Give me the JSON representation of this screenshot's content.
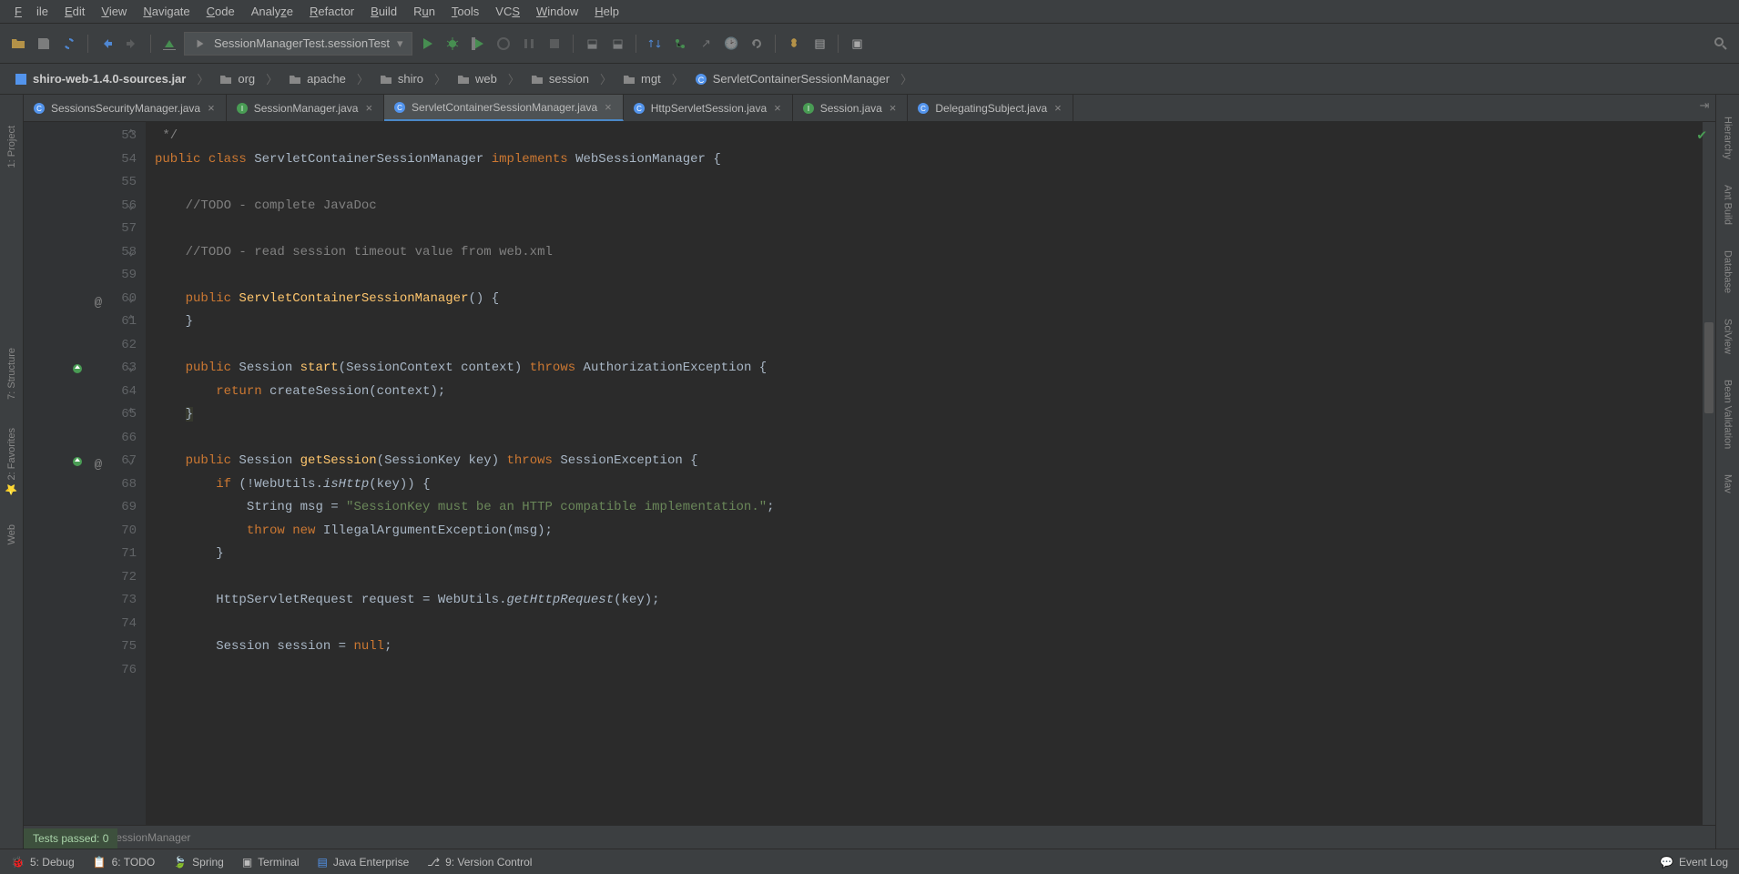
{
  "menu": {
    "file": "File",
    "edit": "Edit",
    "view": "View",
    "navigate": "Navigate",
    "code": "Code",
    "analyze": "Analyze",
    "refactor": "Refactor",
    "build": "Build",
    "run": "Run",
    "tools": "Tools",
    "vcs": "VCS",
    "window": "Window",
    "help": "Help"
  },
  "run_config": "SessionManagerTest.sessionTest",
  "breadcrumb": [
    "shiro-web-1.4.0-sources.jar",
    "org",
    "apache",
    "shiro",
    "web",
    "session",
    "mgt",
    "ServletContainerSessionManager"
  ],
  "tabs": [
    {
      "label": "SessionsSecurityManager.java",
      "active": false
    },
    {
      "label": "SessionManager.java",
      "active": false
    },
    {
      "label": "ServletContainerSessionManager.java",
      "active": true
    },
    {
      "label": "HttpServletSession.java",
      "active": false
    },
    {
      "label": "Session.java",
      "active": false
    },
    {
      "label": "DelegatingSubject.java",
      "active": false
    }
  ],
  "line_numbers": [
    "53",
    "54",
    "55",
    "56",
    "57",
    "58",
    "59",
    "60",
    "61",
    "62",
    "63",
    "64",
    "65",
    "66",
    "67",
    "68",
    "69",
    "70",
    "71",
    "72",
    "73",
    "74",
    "75",
    "76"
  ],
  "code_lines": {
    "l53": "*/",
    "l54a": "public",
    "l54b": " class",
    "l54c": " ServletContainerSessionManager ",
    "l54d": "implements",
    "l54e": " WebSessionManager {",
    "l56": "//TODO - complete JavaDoc",
    "l58": "//TODO - read session timeout value from web.xml",
    "l60a": "public",
    "l60b": " ServletContainerSessionManager",
    "l60c": "() {",
    "l61": "}",
    "l63a": "public",
    "l63b": " Session ",
    "l63c": "start",
    "l63d": "(SessionContext context) ",
    "l63e": "throws",
    "l63f": " AuthorizationException {",
    "l64a": "return",
    "l64b": " createSession(context);",
    "l65": "}",
    "l67a": "public",
    "l67b": " Session ",
    "l67c": "getSession",
    "l67d": "(SessionKey key) ",
    "l67e": "throws",
    "l67f": " SessionException {",
    "l68a": "if",
    "l68b": " (!WebUtils.",
    "l68c": "isHttp",
    "l68d": "(key)) {",
    "l69a": "String msg = ",
    "l69b": "\"SessionKey must be an HTTP compatible implementation.\"",
    "l69c": ";",
    "l70a": "throw",
    "l70b": " new",
    "l70c": " IllegalArgumentException(msg);",
    "l71": "}",
    "l73a": "HttpServletRequest request = WebUtils.",
    "l73b": "getHttpRequest",
    "l73c": "(key);",
    "l75a": "Session session = ",
    "l75b": "null",
    "l75c": ";"
  },
  "breadcrumb_bottom": "ervletContainerSessionManager",
  "left_tools": {
    "project": "1: Project",
    "structure": "7: Structure",
    "favorites": "2: Favorites",
    "web": "Web"
  },
  "right_tools": {
    "hierarchy": "Hierarchy",
    "antbuild": "Ant Build",
    "database": "Database",
    "sciview": "SciView",
    "beanvalidation": "Bean Validation",
    "mav": "Mav"
  },
  "bottom": {
    "debug": "5: Debug",
    "todo": "6: TODO",
    "spring": "Spring",
    "terminal": "Terminal",
    "javaee": "Java Enterprise",
    "vc": "9: Version Control",
    "eventlog": "Event Log"
  },
  "tests_passed": "Tests passed: 0"
}
